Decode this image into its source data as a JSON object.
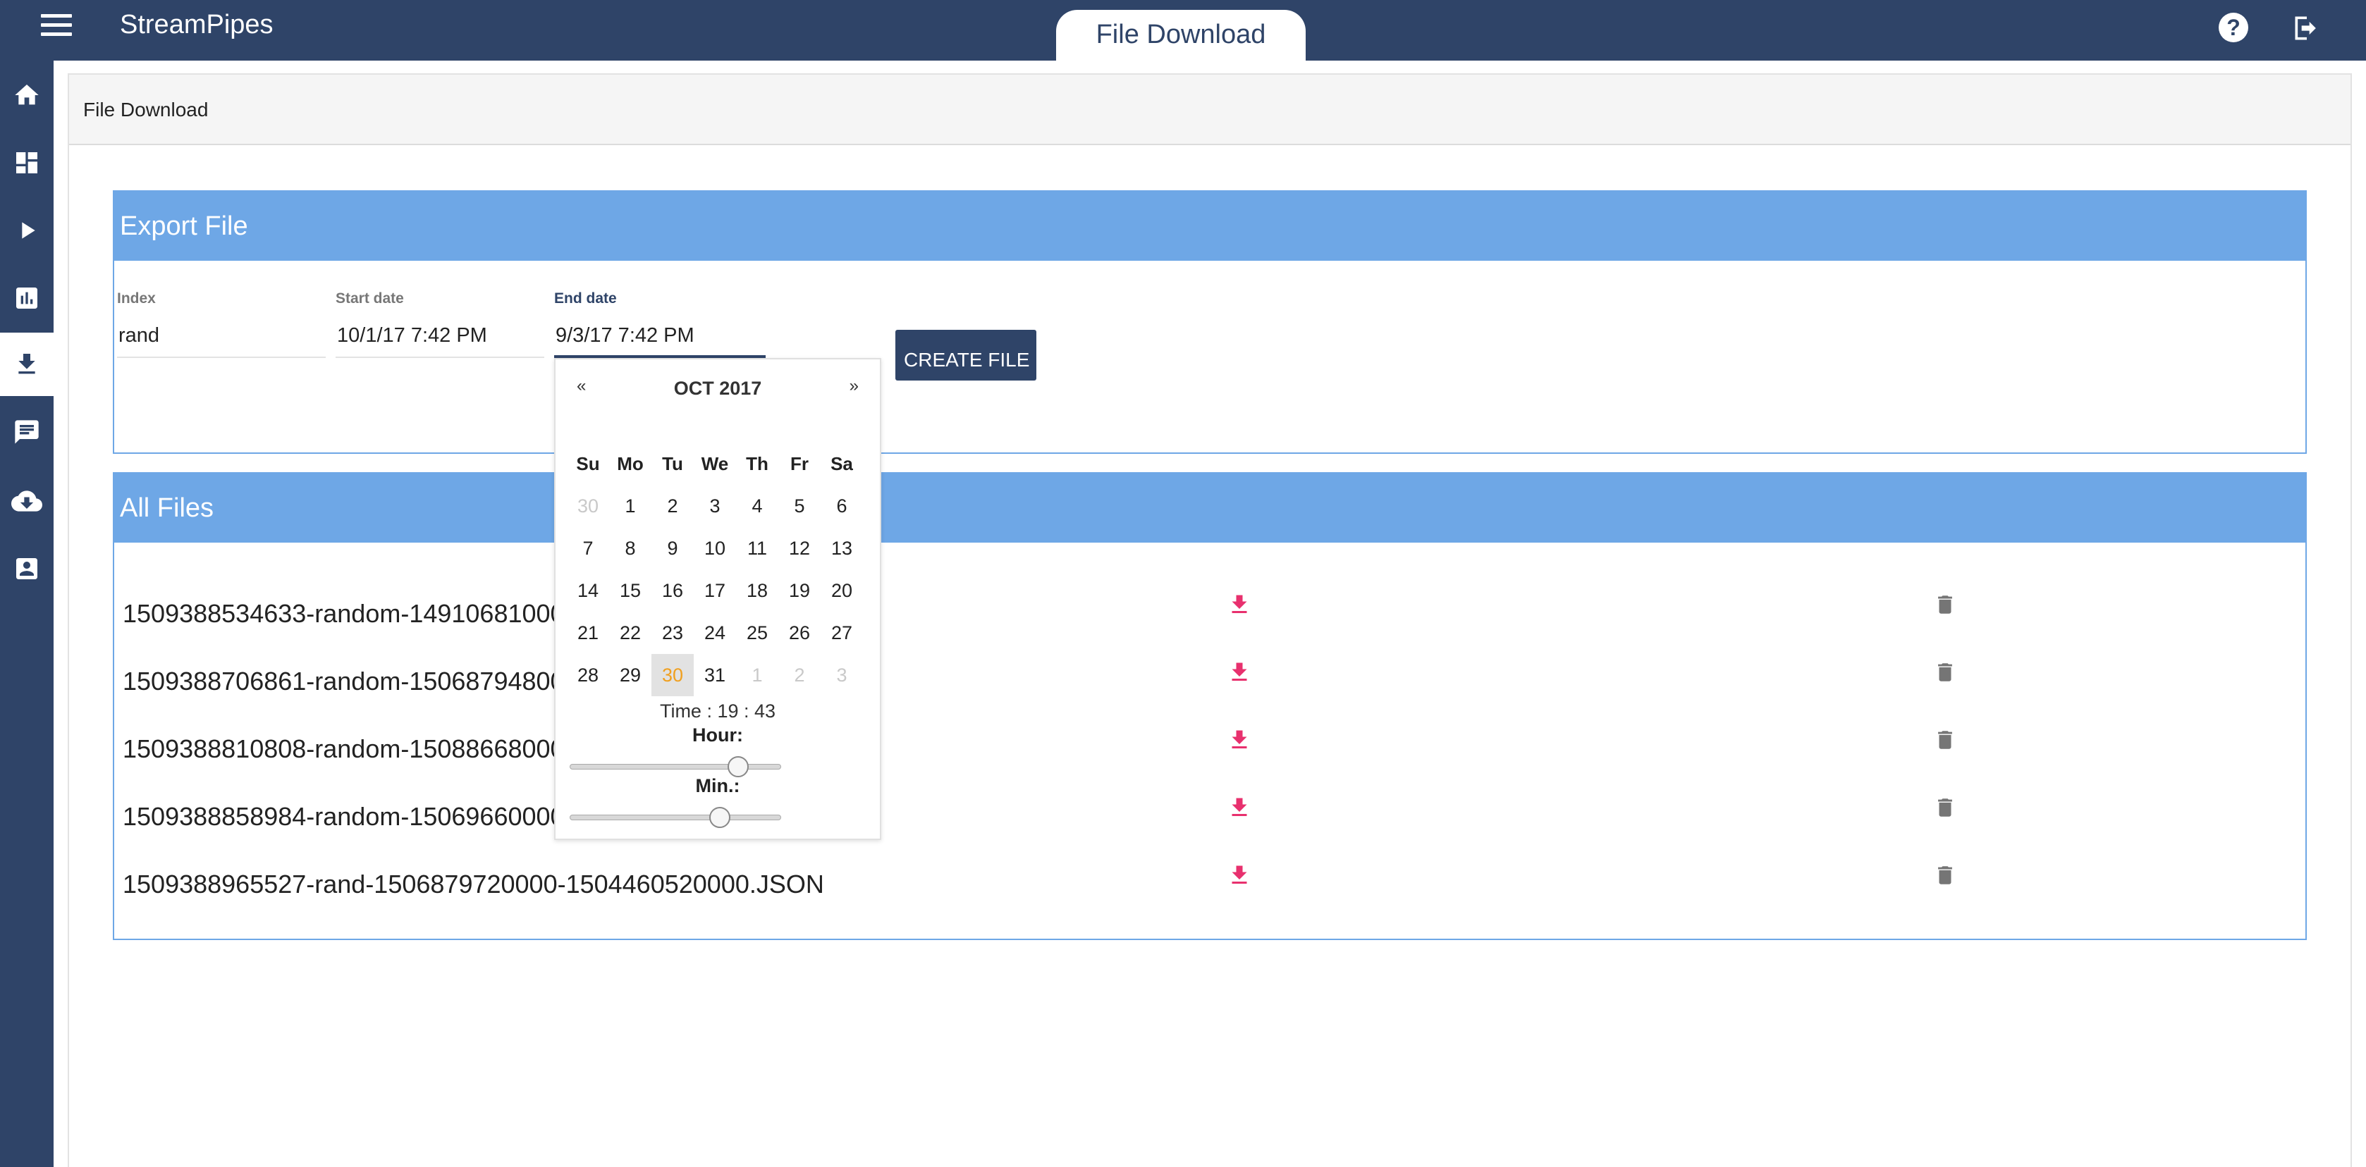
{
  "header": {
    "app_title": "StreamPipes",
    "active_tab": "File Download",
    "icons": [
      "menu-icon",
      "help-icon",
      "logout-icon"
    ]
  },
  "sidebar": {
    "items": [
      {
        "icon": "home-icon"
      },
      {
        "icon": "dashboard-icon"
      },
      {
        "icon": "play-icon"
      },
      {
        "icon": "bar-chart-icon"
      },
      {
        "icon": "download-icon",
        "active": true
      },
      {
        "icon": "message-icon"
      },
      {
        "icon": "cloud-download-icon"
      },
      {
        "icon": "contact-icon"
      }
    ]
  },
  "breadcrumb": "File Download",
  "export_card": {
    "title": "Export File",
    "index_label": "Index",
    "index_value": "rand",
    "start_label": "Start date",
    "start_value": "10/1/17 7:42 PM",
    "end_label": "End date",
    "end_value": "9/3/17 7:42 PM",
    "create_button": "CREATE FILE"
  },
  "files_card": {
    "title": "All Files",
    "files": [
      "1509388534633-random-14910681000",
      "1509388706861-random-15068794800",
      "1509388810808-random-15088668000",
      "1509388858984-random-15069660000",
      "1509388965527-rand-1506879720000-1504460520000.JSON"
    ]
  },
  "datepicker": {
    "prev": "«",
    "next": "»",
    "month_label": "OCT 2017",
    "weekdays": [
      "Su",
      "Mo",
      "Tu",
      "We",
      "Th",
      "Fr",
      "Sa"
    ],
    "weeks": [
      [
        "30",
        "1",
        "2",
        "3",
        "4",
        "5",
        "6"
      ],
      [
        "7",
        "8",
        "9",
        "10",
        "11",
        "12",
        "13"
      ],
      [
        "14",
        "15",
        "16",
        "17",
        "18",
        "19",
        "20"
      ],
      [
        "21",
        "22",
        "23",
        "24",
        "25",
        "26",
        "27"
      ],
      [
        "28",
        "29",
        "30",
        "31",
        "1",
        "2",
        "3"
      ]
    ],
    "time_label": "Time : 19 : 43",
    "hour_label": "Hour:",
    "min_label": "Min.:",
    "hour_value": 19,
    "hour_max": 23,
    "minute_value": 43,
    "minute_max": 59,
    "today_color": "#f0a020"
  },
  "colors": {
    "nav": "#2f4468",
    "card_header": "#6ea7e6",
    "download_icon": "#e8306e",
    "trash_icon": "#757575"
  }
}
